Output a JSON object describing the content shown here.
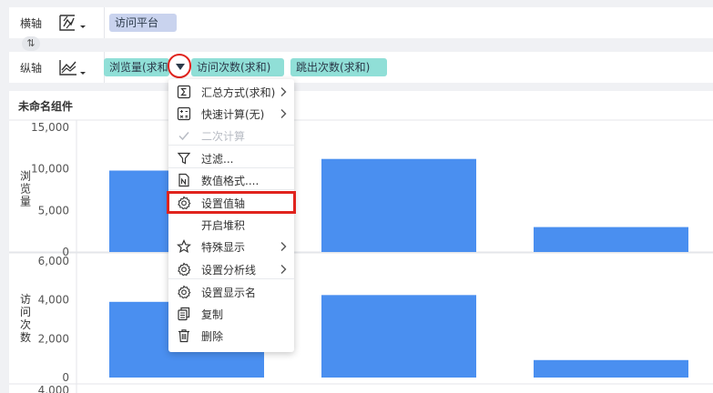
{
  "shelves": {
    "x_axis": {
      "label": "横轴",
      "icon": "chart-type-icon",
      "fields": [
        "访问平台"
      ]
    },
    "y_axis": {
      "label": "纵轴",
      "icon": "line-chart-type-icon",
      "fields": [
        "浏览量(求和",
        "访问次数(求和)",
        "跳出次数(求和)"
      ]
    },
    "swap_icon": "⇅"
  },
  "component": {
    "title": "未命名组件"
  },
  "context_menu": {
    "items": [
      {
        "label": "汇总方式(求和)",
        "icon": "sum-icon",
        "submenu": true,
        "disabled": false
      },
      {
        "label": "快速计算(无)",
        "icon": "calculator-icon",
        "submenu": true,
        "disabled": false
      },
      {
        "label": "二次计算",
        "icon": "check-icon",
        "submenu": false,
        "disabled": true
      },
      {
        "label": "过滤...",
        "icon": "filter-icon",
        "submenu": false,
        "disabled": false
      },
      {
        "label": "数值格式....",
        "icon": "number-format-icon",
        "submenu": false,
        "disabled": false
      },
      {
        "label": "设置值轴",
        "icon": "gear-icon",
        "submenu": false,
        "disabled": false
      },
      {
        "label": "开启堆积",
        "icon": "",
        "submenu": false,
        "disabled": false
      },
      {
        "label": "特殊显示",
        "icon": "star-icon",
        "submenu": true,
        "disabled": false
      },
      {
        "label": "设置分析线",
        "icon": "gear-icon",
        "submenu": true,
        "disabled": false
      },
      {
        "label": "设置显示名",
        "icon": "gear-icon",
        "submenu": false,
        "disabled": false
      },
      {
        "label": "复制",
        "icon": "copy-icon",
        "submenu": false,
        "disabled": false
      },
      {
        "label": "删除",
        "icon": "trash-icon",
        "submenu": false,
        "disabled": false
      }
    ]
  },
  "colors": {
    "bar": "#4a8ff0",
    "pill_x": "#c9d3ee",
    "pill_y": "#90dfd7",
    "highlight": "#e0231d"
  },
  "chart_data": [
    {
      "type": "bar",
      "ylabel": "浏览量",
      "ylim": [
        0,
        15000
      ],
      "yticks": [
        "0",
        "5,000",
        "10,000",
        "15,000"
      ],
      "categories": [
        "",
        "",
        ""
      ],
      "values": [
        9800,
        11200,
        3000
      ]
    },
    {
      "type": "bar",
      "ylabel": "访问次数",
      "ylim": [
        0,
        6000
      ],
      "yticks": [
        "0",
        "2,000",
        "4,000",
        "6,000"
      ],
      "categories": [
        "",
        "",
        ""
      ],
      "values": [
        3900,
        4250,
        900
      ]
    },
    {
      "type": "bar",
      "ylabel": "",
      "ylim": [
        0,
        4000
      ],
      "yticks": [
        "4,000"
      ],
      "categories": [
        "",
        "",
        ""
      ],
      "values": []
    }
  ]
}
